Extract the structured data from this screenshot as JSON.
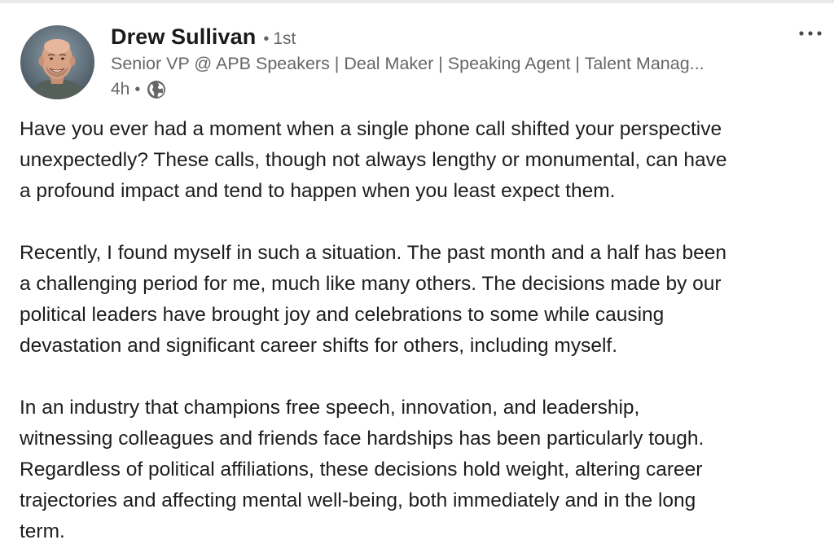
{
  "post": {
    "author": {
      "name": "Drew Sullivan",
      "degree": "1st",
      "headline": "Senior VP @ APB Speakers | Deal Maker | Speaking Agent | Talent Manag...",
      "time": "4h",
      "visibility_icon": "globe-icon",
      "avatar_icon": "profile-photo"
    },
    "menu_icon": "more-options-icon",
    "separator": "•",
    "body": {
      "paragraph1": [
        "Have you ever had a moment when a single phone call shifted your perspective",
        "unexpectedly? These calls, though not always lengthy or monumental, can have",
        "a profound impact and tend to happen when you least expect them."
      ],
      "paragraph2": [
        "Recently, I found myself in such a situation. The past month and a half has been",
        "a challenging period for me, much like many others. The decisions made by our",
        "political leaders have brought joy and celebrations to some while causing",
        "devastation and significant career shifts for others, including myself."
      ],
      "paragraph3": [
        "In an industry that champions free speech, innovation, and leadership,",
        "witnessing colleagues and friends face hardships has been particularly tough.",
        "Regardless of political affiliations, these decisions hold weight, altering career",
        "trajectories and affecting mental well-being, both immediately and in the long",
        "term."
      ]
    }
  },
  "colors": {
    "primary_text": "#1d1d1d",
    "secondary_text": "#666666",
    "background": "#ffffff"
  }
}
